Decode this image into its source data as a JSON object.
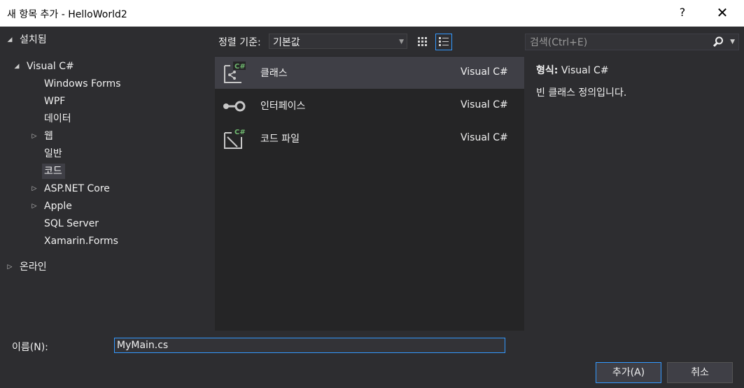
{
  "window": {
    "title": "새 항목 추가 - HelloWorld2",
    "help_label": "?",
    "close_label": "✕"
  },
  "tree": {
    "installed": "설치됨",
    "visual_csharp": "Visual C#",
    "items": [
      "Windows Forms",
      "WPF",
      "데이터",
      "웹",
      "일반",
      "코드",
      "ASP.NET Core",
      "Apple",
      "SQL Server",
      "Xamarin.Forms"
    ],
    "selected": "코드",
    "online": "온라인"
  },
  "toolbar": {
    "sort_label": "정렬 기준:",
    "sort_value": "기본값"
  },
  "templates": [
    {
      "name": "클래스",
      "lang": "Visual C#",
      "icon": "class-icon",
      "selected": true
    },
    {
      "name": "인터페이스",
      "lang": "Visual C#",
      "icon": "interface-icon",
      "selected": false
    },
    {
      "name": "코드 파일",
      "lang": "Visual C#",
      "icon": "code-file-icon",
      "selected": false
    }
  ],
  "search": {
    "placeholder": "검색(Ctrl+E)"
  },
  "details": {
    "type_label": "형식:",
    "type_value": "Visual C#",
    "description": "빈 클래스 정의입니다."
  },
  "footer": {
    "name_label": "이름(N):",
    "name_value": "MyMain.cs",
    "add_label": "추가(A)",
    "cancel_label": "취소"
  },
  "colors": {
    "accent": "#3399ff",
    "background": "#2d2d30",
    "list_bg": "#252526",
    "badge": "#6fb86f"
  }
}
